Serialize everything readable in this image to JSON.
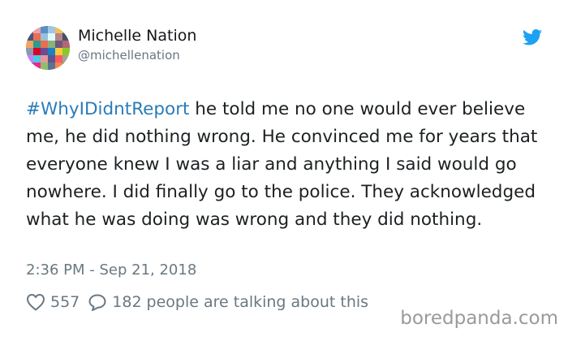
{
  "tweet": {
    "author_name": "Michelle Nation",
    "author_handle": "@michellenation",
    "hashtag": "#WhyIDidntReport",
    "body": " he told me no one would ever believe me, he did nothing wrong. He convinced me for years that everyone knew I was a liar and anything I said would go nowhere. I did finally go to the police. They acknowledged what he was doing was wrong and they did nothing.",
    "timestamp": "2:36 PM - Sep 21, 2018",
    "likes": "557",
    "replies": "182",
    "talking_text": "people are talking about this"
  },
  "icons": {
    "platform": "twitter-bird-icon",
    "like": "heart-icon",
    "reply": "speech-bubble-icon"
  },
  "colors": {
    "hashtag": "#2b7bb9",
    "twitter_blue": "#1da1f2",
    "meta_gray": "#697882"
  },
  "watermark": "boredpanda.com"
}
